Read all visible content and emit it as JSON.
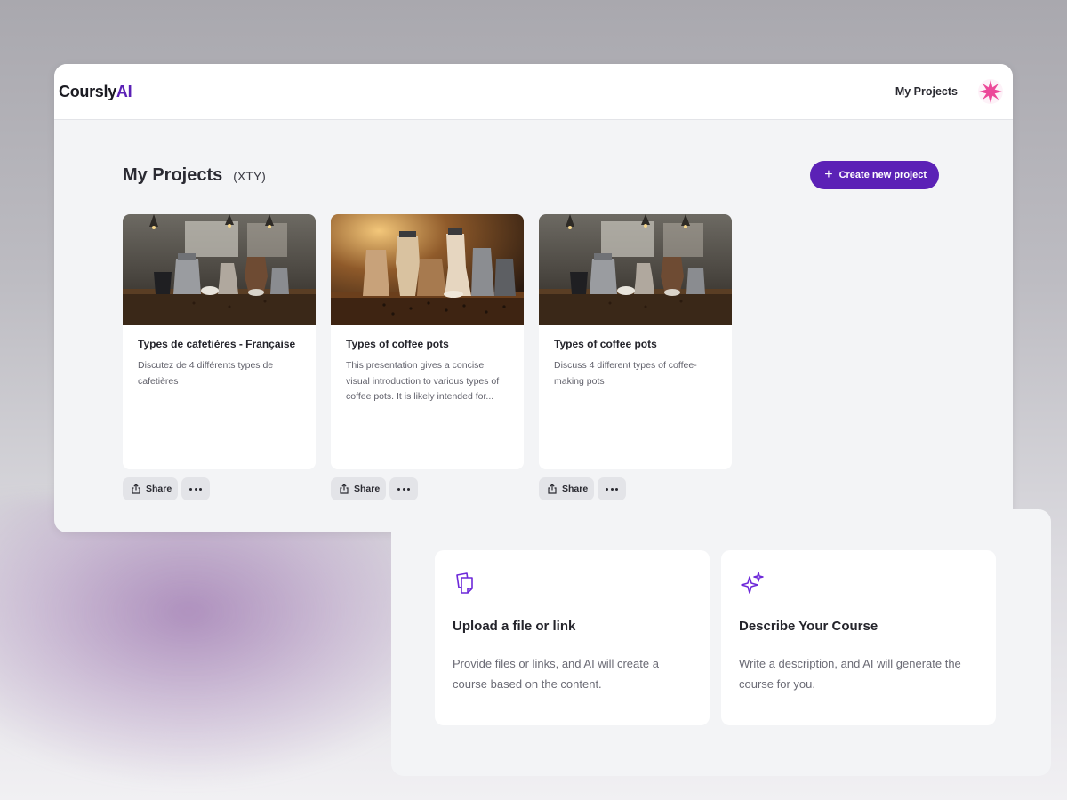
{
  "app": {
    "logo_text": "Coursly",
    "logo_accent": "AI",
    "brand_color": "#5b21b6"
  },
  "topbar": {
    "nav_link": "My Projects",
    "avatar_icon": "pink-star-avatar-icon"
  },
  "page": {
    "title": "My Projects",
    "subtitle": "(XTY)",
    "create_button_label": "Create new project"
  },
  "projects": [
    {
      "title": "Types de cafetières - Française",
      "description": "Discutez de 4 différents types de cafetières",
      "share_label": "Share",
      "thumbnail_icon": "coffee-kitchen-image"
    },
    {
      "title": "Types of coffee pots",
      "description": "This presentation gives a concise visual introduction to various types of coffee pots. It is likely intended for...",
      "share_label": "Share",
      "thumbnail_icon": "coffee-pots-warm-image"
    },
    {
      "title": "Types of coffee pots",
      "description": "Discuss 4 different types of coffee-making pots",
      "share_label": "Share",
      "thumbnail_icon": "coffee-kitchen-image"
    }
  ],
  "options": [
    {
      "title": "Upload a file or link",
      "description": "Provide files or links, and AI will create a course based on the content.",
      "icon": "files-icon"
    },
    {
      "title": "Describe Your Course",
      "description": "Write a description, and AI will generate the course for you.",
      "icon": "sparkles-icon"
    }
  ]
}
